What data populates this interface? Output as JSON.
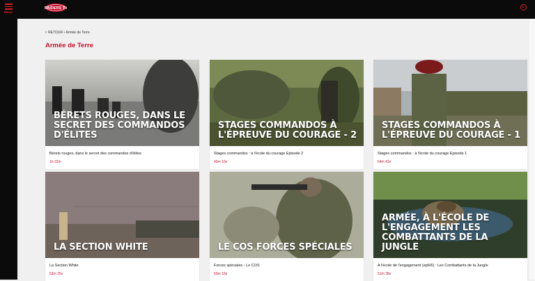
{
  "header": {
    "menu_label": "Menu",
    "logo_text": "RAIDERS TV"
  },
  "breadcrumb": {
    "back_label": "RETOUR",
    "separator": "•",
    "current": "Armée de Terre"
  },
  "page_title": "Armée de Terre",
  "colors": {
    "accent": "#c8102e",
    "topbar": "#0b0b0b",
    "background": "#f0f0f0"
  },
  "cards": [
    {
      "overlay": "Bérets rouges, dans le secret des commandos d'élites",
      "title": "Bérets rouges, dans le secret des commandos d'élites",
      "duration": "1h 22m"
    },
    {
      "overlay": "Stages commandos à l'épreuve du courage - 2",
      "title": "Stages commandos : à l'école du courage Episode 2",
      "duration": "43m 10s"
    },
    {
      "overlay": "Stages commandos à l'épreuve du courage - 1",
      "title": "Stages commandos : à l'école du courage Episode 1",
      "duration": "54m 43s"
    },
    {
      "overlay": "La section white",
      "title": "La Section White",
      "duration": "53m 25s"
    },
    {
      "overlay": "Le COS forces spéciales",
      "title": "Forces spéciales - Le COS",
      "duration": "59m 19s"
    },
    {
      "overlay": "Armée, à l'école de l'engagement les combattants de la jungle",
      "title": "A l'école de l'engagement (ep6/6) : Les Combattants de la Jungle",
      "duration": "51m 38s"
    }
  ]
}
